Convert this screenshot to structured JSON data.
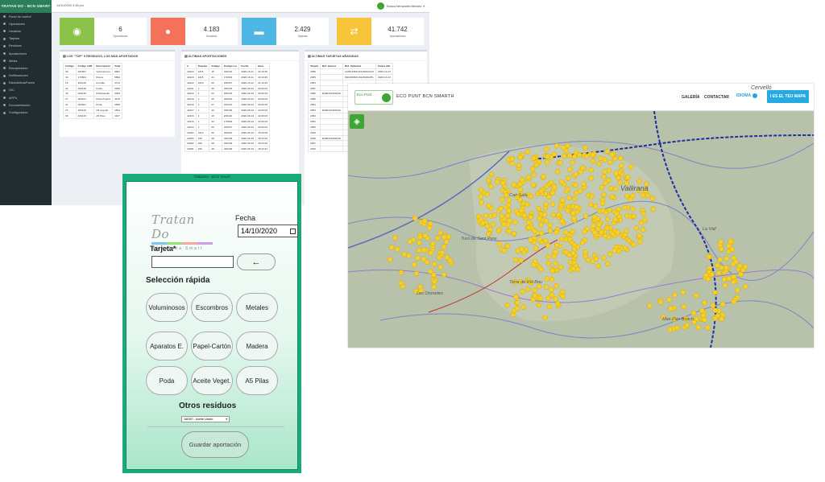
{
  "dashboard": {
    "brand": "TRATAN DO - BCN SMART",
    "datetime": "14/10/2020 3:35 pm",
    "user": "Toosca Hernandez Mendez",
    "nav": [
      "Panel de control",
      "Operadores",
      "Usuarios",
      "Tarjetas",
      "Residuos",
      "Aportaciones",
      "Media",
      "Recuperación",
      "Notificaciones",
      "Estadísticas/Faves",
      "OIC",
      "APP's",
      "Documentación",
      "Configuración"
    ],
    "stats": [
      {
        "value": "6",
        "label": "Operadores",
        "color": "#8bc34a",
        "icon": "eye-icon"
      },
      {
        "value": "4.183",
        "label": "Usuarios",
        "color": "#f4715a",
        "icon": "user-icon"
      },
      {
        "value": "2.429",
        "label": "Tarjetas",
        "color": "#4fb7e6",
        "icon": "card-icon"
      },
      {
        "value": "41.742",
        "label": "Aportaciones",
        "color": "#f7c43a",
        "icon": "refresh-icon"
      }
    ],
    "panel_top": {
      "title": "LOS \"TOP\" 9 RESIDUOS, LOS MÁS APORTADOS",
      "headers": [
        "Código",
        "Código LER",
        "Descripción",
        "Total"
      ],
      "rows": [
        [
          "09",
          "200307",
          "Voluminosos",
          "9981"
        ],
        [
          "34",
          "170604",
          "Runes",
          "5894"
        ],
        [
          "16",
          "200140",
          "Ferralla",
          "3714"
        ],
        [
          "22",
          "200138",
          "Fusta",
          "3456"
        ],
        [
          "40",
          "200136",
          "FM/Aparells",
          "3354"
        ],
        [
          "27",
          "200101",
          "Paper/Cartró",
          "3078"
        ],
        [
          "21",
          "200201",
          "Poda",
          "2899"
        ],
        [
          "23",
          "200126",
          "Oli vegetal",
          "1591"
        ],
        [
          "38",
          "200133",
          "A5 Piles",
          "1167"
        ]
      ]
    },
    "panel_aport": {
      "title": "ÚLTIMAS APORTACIONES",
      "headers": [
        "#",
        "Tarjetas",
        "Código",
        "Código Ler",
        "Fecha",
        "Hora"
      ],
      "rows": [
        [
          "42224",
          "2215",
          "15",
          "200140",
          "2020-10-11",
          "22:10:45"
        ],
        [
          "42223",
          "2215",
          "34",
          "170604",
          "2020-10-11",
          "22:10:45"
        ],
        [
          "42222",
          "2215",
          "09",
          "200307",
          "2020-10-11",
          "22:10:45"
        ],
        [
          "42221",
          "1",
          "35",
          "200133",
          "2020-09-24",
          "22:00:03"
        ],
        [
          "42220",
          "1",
          "24",
          "200125",
          "2020-09-24",
          "22:00:03"
        ],
        [
          "42219",
          "1",
          "26",
          "200201",
          "2020-09-24",
          "22:00:03"
        ],
        [
          "42218",
          "1",
          "27",
          "200101",
          "2020-09-24",
          "22:00:03"
        ],
        [
          "42217",
          "1",
          "40",
          "200136",
          "2020-09-24",
          "22:00:03"
        ],
        [
          "42216",
          "1",
          "16",
          "200140",
          "2020-09-24",
          "22:00:03"
        ],
        [
          "42215",
          "1",
          "34",
          "170604",
          "2020-09-24",
          "22:00:03"
        ],
        [
          "42214",
          "1",
          "09",
          "200307",
          "2020-09-24",
          "22:00:03"
        ],
        [
          "42284",
          "1212",
          "20",
          "200201",
          "2020-09-19",
          "15:29:09"
        ],
        [
          "42283",
          "100",
          "48",
          "200139",
          "2020-09-19",
          "15:23:22"
        ],
        [
          "42282",
          "100",
          "48",
          "200139",
          "2020-09-19",
          "15:23:22"
        ],
        [
          "42281",
          "100",
          "48",
          "200139",
          "2020-09-19",
          "15:23:22"
        ]
      ]
    },
    "panel_cards": {
      "title": "ÚLTIMAS TARJETAS AÑADIDAS",
      "headers": [
        "Tarjeta",
        "Ref. interna",
        "Ref. Catastral",
        "Fecha alta"
      ],
      "rows": [
        [
          "2956",
          "",
          "1125133DF1812N0012AX",
          "2020-10-13"
        ],
        [
          "2955",
          "",
          "6821605DF1812S0014HL",
          "2020-10-13"
        ],
        [
          "2954",
          "",
          "",
          ""
        ],
        [
          "2957",
          "",
          "",
          ""
        ],
        [
          "2956",
          "E09010130423A",
          "",
          ""
        ],
        [
          "2955",
          "",
          "",
          ""
        ],
        [
          "2954",
          "",
          "",
          ""
        ],
        [
          "2953",
          "E09010130423A",
          "",
          ""
        ],
        [
          "2952",
          "",
          "",
          ""
        ],
        [
          "2951",
          "",
          "",
          ""
        ],
        [
          "2950",
          "",
          "",
          ""
        ],
        [
          "2949",
          "",
          "",
          ""
        ],
        [
          "2948",
          "E09010130423A",
          "",
          ""
        ],
        [
          "2947",
          "",
          "",
          ""
        ],
        [
          "2946",
          "",
          "",
          ""
        ]
      ]
    }
  },
  "form": {
    "window_title": "TratanDo - BCN Smart",
    "logo_text": "Tratan Do",
    "logo_sub": "Barcelona Smart",
    "fecha_label": "Fecha",
    "fecha_value": "14/10/2020",
    "tarjeta_label": "Tarjeta*",
    "back_label": "←",
    "quick_title": "Selección rápida",
    "buttons": [
      "Voluminosos",
      "Escombros",
      "Metales",
      "Aparatos E.",
      "Papel-Cartón",
      "Madera",
      "Poda",
      "Aceite Veget.",
      "A5 Pilas"
    ],
    "otros_title": "Otros residuos",
    "otros_value": "180307 - Aceite Usado",
    "save_label": "Guardar aportación"
  },
  "map": {
    "logo_text": "Eco Punt",
    "title": "ECO PUNT BCN SMARTH",
    "nav": [
      "GALERÍA",
      "CONTACTAR"
    ],
    "lang": "IDIOMA",
    "map_button": "I ES EL TEU MAPA",
    "place_labels": [
      "Vallirana",
      "Can Sala",
      "Turó de Sant Pere",
      "La Vall",
      "Les Orenetes",
      "Torre de Pol Bou",
      "Mas d'en Bosch"
    ],
    "top_label": "Cervelló"
  }
}
